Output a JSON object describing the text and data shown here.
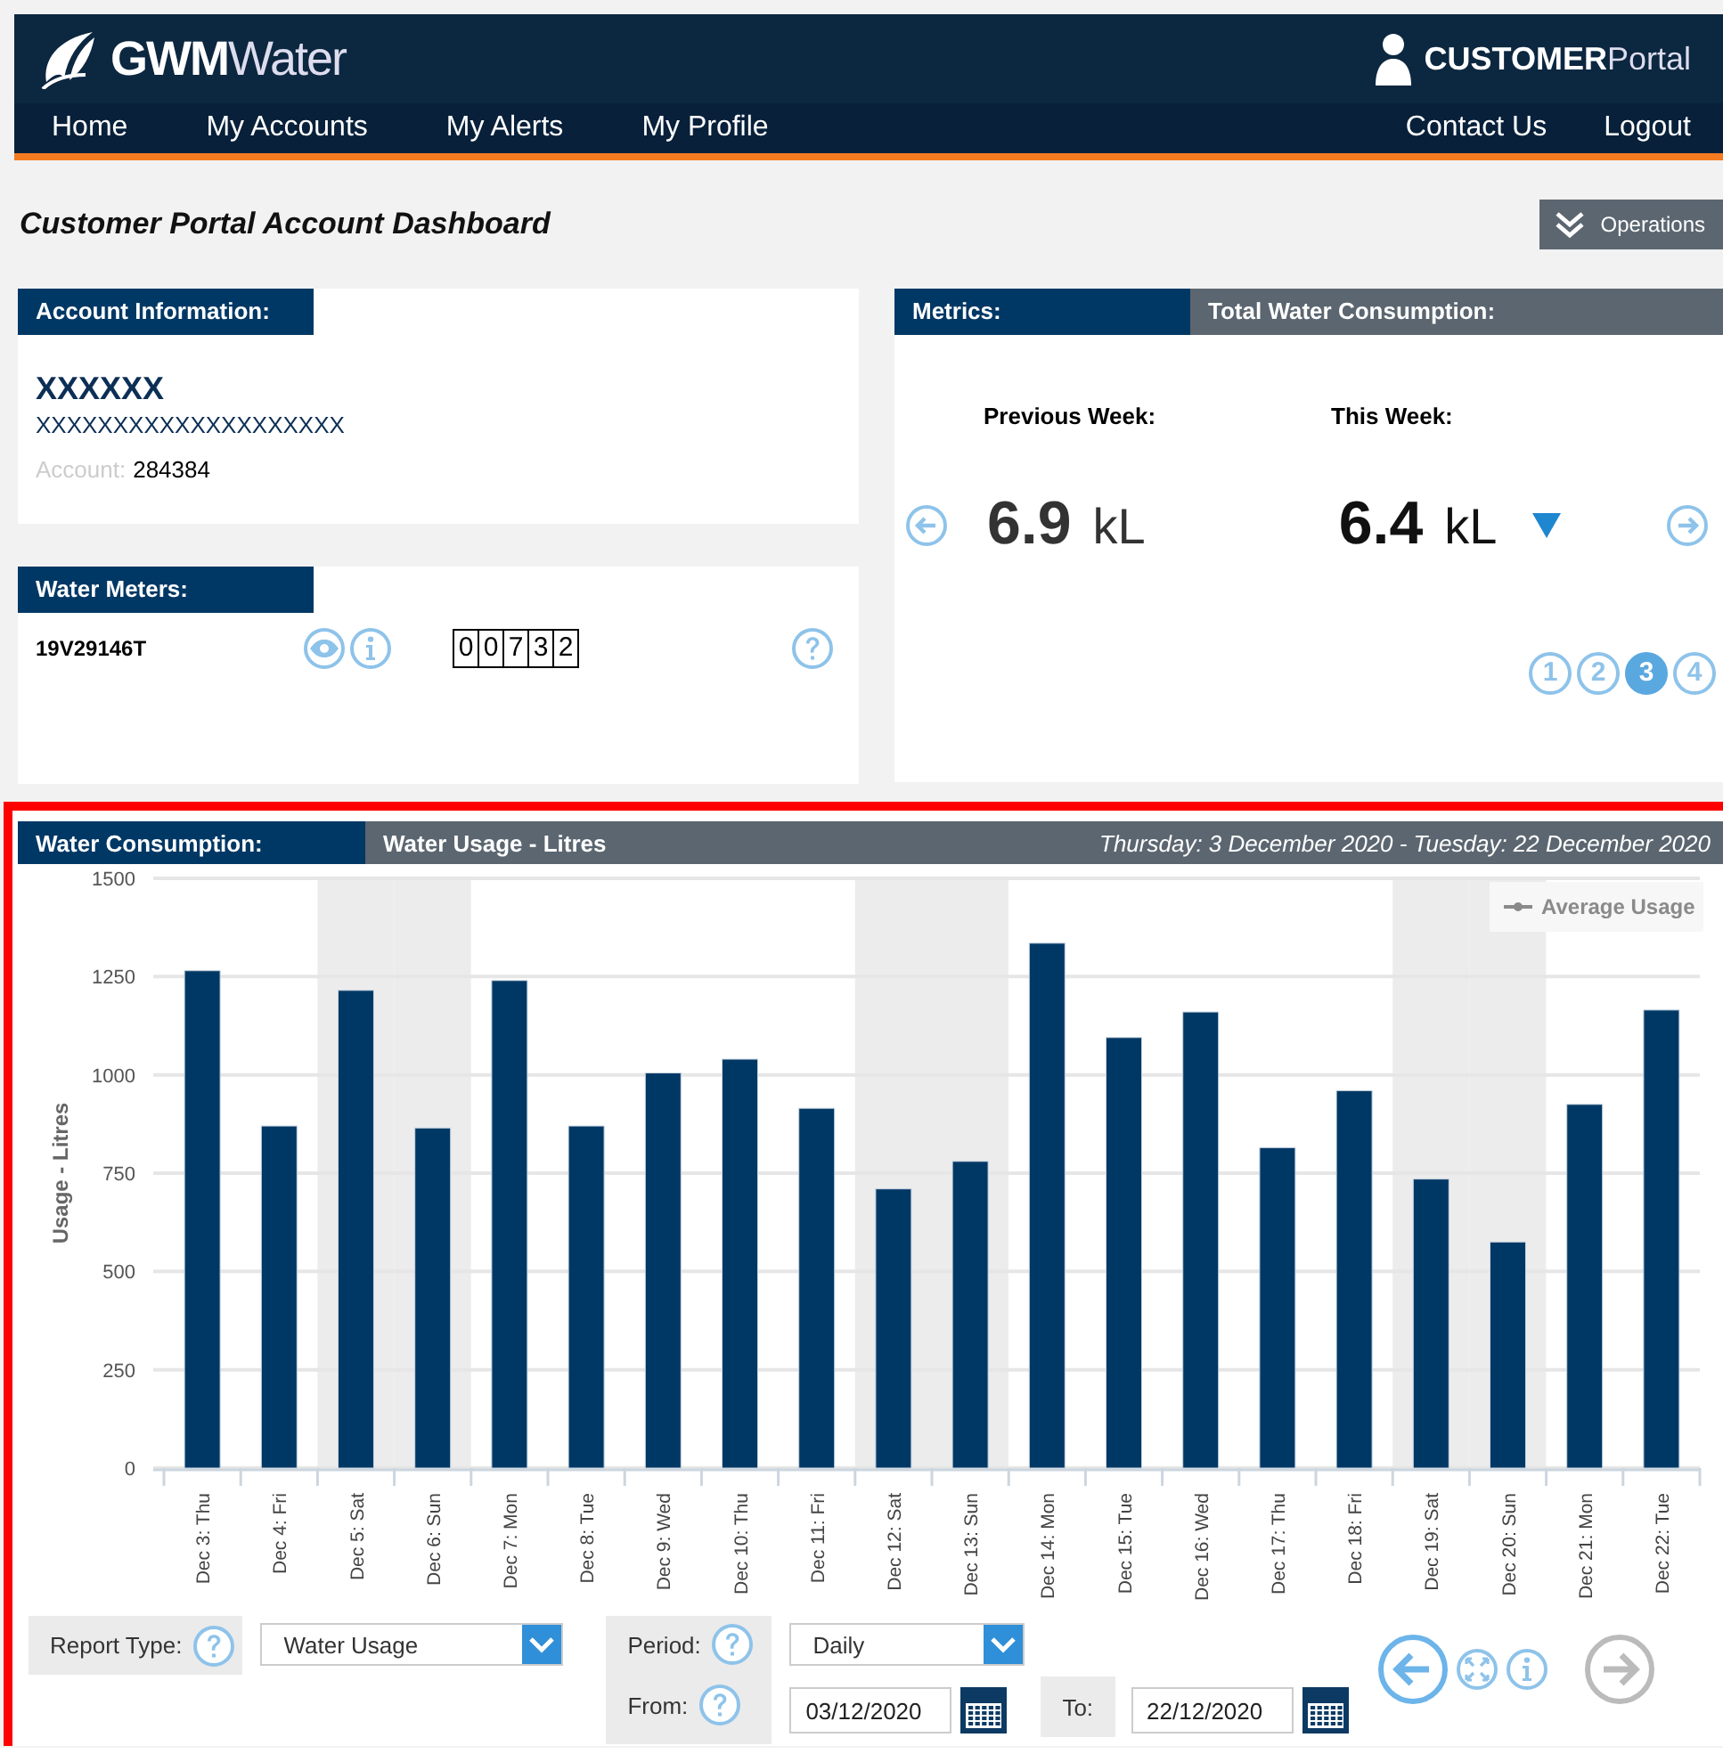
{
  "header": {
    "logo_bold": "GWM",
    "logo_light": "Water",
    "portal_bold": "CUSTOMER",
    "portal_light": "Portal"
  },
  "nav": {
    "left": [
      {
        "label": "Home"
      },
      {
        "label": "My Accounts"
      },
      {
        "label": "My Alerts"
      },
      {
        "label": "My Profile"
      }
    ],
    "right": [
      {
        "label": "Contact Us"
      },
      {
        "label": "Logout"
      }
    ]
  },
  "page_title": "Customer Portal Account Dashboard",
  "operations_button": "Operations",
  "account_info": {
    "title": "Account Information:",
    "name": "XXXXXX",
    "address": "XXXXXXXXXXXXXXXXXXXX",
    "account_label": "Account:",
    "account_number": "284384"
  },
  "water_meters": {
    "title": "Water Meters:",
    "meters": [
      {
        "id": "19V29146T",
        "digits": [
          "0",
          "0",
          "7",
          "3",
          "2"
        ]
      }
    ]
  },
  "metrics": {
    "title": "Metrics:",
    "subtitle": "Total Water Consumption:",
    "previous_label": "Previous Week:",
    "previous_value": "6.9",
    "previous_unit": "kL",
    "this_label": "This Week:",
    "this_value": "6.4",
    "this_unit": "kL",
    "decreased": true,
    "pages": [
      {
        "label": "1",
        "selected": false
      },
      {
        "label": "2",
        "selected": false
      },
      {
        "label": "3",
        "selected": true
      },
      {
        "label": "4",
        "selected": false
      }
    ]
  },
  "consumption": {
    "title": "Water Consumption:",
    "subtitle": "Water Usage - Litres",
    "date_range": "Thursday: 3 December 2020 - Tuesday: 22 December 2020",
    "legend": [
      {
        "label": "Average Usage",
        "hidden": true
      }
    ],
    "weekend": [
      false,
      false,
      true,
      true,
      false,
      false,
      false,
      false,
      false,
      true,
      true,
      false,
      false,
      false,
      false,
      false,
      true,
      true,
      false,
      false
    ],
    "chart_data": {
      "type": "bar",
      "grid": true,
      "ylabel": "Usage - Litres",
      "ylim": [
        0,
        1500
      ],
      "yticks": [
        0,
        250,
        500,
        750,
        1000,
        1250,
        1500
      ],
      "categories": [
        "Dec 3: Thu",
        "Dec 4: Fri",
        "Dec 5: Sat",
        "Dec 6: Sun",
        "Dec 7: Mon",
        "Dec 8: Tue",
        "Dec 9: Wed",
        "Dec 10: Thu",
        "Dec 11: Fri",
        "Dec 12: Sat",
        "Dec 13: Sun",
        "Dec 14: Mon",
        "Dec 15: Tue",
        "Dec 16: Wed",
        "Dec 17: Thu",
        "Dec 18: Fri",
        "Dec 19: Sat",
        "Dec 20: Sun",
        "Dec 21: Mon",
        "Dec 22: Tue"
      ],
      "series": [
        {
          "color": "#003865",
          "values": [
            1265,
            870,
            1215,
            865,
            1240,
            870,
            1005,
            1040,
            915,
            710,
            780,
            1335,
            1095,
            1160,
            815,
            960,
            735,
            575,
            925,
            1165
          ]
        }
      ]
    }
  },
  "controls": {
    "report_type_label": "Report Type:",
    "report_type": "Water Usage",
    "period_label": "Period:",
    "period": "Daily",
    "from_label": "From:",
    "from": "03/12/2020",
    "to_label": "To:",
    "to": "22/12/2020"
  }
}
